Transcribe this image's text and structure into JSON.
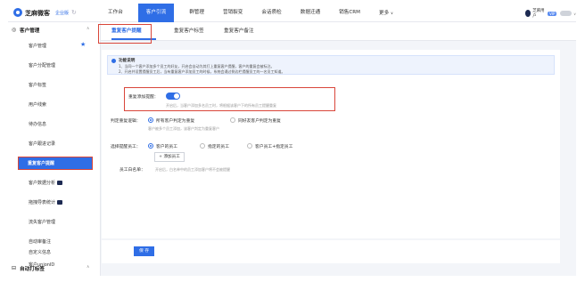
{
  "app": {
    "title": "芝麻微客",
    "version": "企业版"
  },
  "nav": {
    "items": [
      "工作台",
      "客户引流",
      "群管理",
      "营销裂变",
      "会话质检",
      "数据迁通",
      "销售CRM",
      "更多"
    ],
    "more_arrow": "∨"
  },
  "user": {
    "name": "芝麻用户",
    "badge": "VIP"
  },
  "sidebar": {
    "group1": "客户管理",
    "items": [
      "客户管理",
      "客户分配管理",
      "客户标签",
      "用户线索",
      "待办信息",
      "客户跟进记录",
      "重复客户提醒",
      "客户数据分析",
      "拖拽导表统计",
      "流失客户管理",
      "自动审备注",
      "自定义信息",
      "客户unionID"
    ],
    "group2": "自动打标签"
  },
  "tabs": [
    "重复客户提醒",
    "重复客户标签",
    "重复客户备注"
  ],
  "notice": {
    "title": "功能说明",
    "lines": [
      "1、当同一个客户添加多个员工的好友，开启会自动为其打上重复客户提醒，客户的重复会被标注。",
      "2、开启并设置提醒员工后，当有重复客户添加员工的时候，系统会通过侧边栏提醒员工的一名员工知道。"
    ]
  },
  "settings": {
    "toggle_label": "重复添加提醒：",
    "toggle_hint": "开启后，当客户添加多名员工时，将根据该客户下的所有员工提醒重复",
    "logic_label": "判定重复逻辑：",
    "logic_options": [
      "所有客户判定为重复",
      "同好友客户判定为重复"
    ],
    "logic_hint": "客户被多个员工添加，该客户判定为重复客户",
    "employee_label": "选择提醒员工：",
    "employee_options": [
      "客户的员工",
      "指定的员工",
      "客户员工+指定员工"
    ],
    "whitelist_label": "员工白名单：",
    "whitelist_hint": "开启后，白名单中的员工添加客户将不会被提醒",
    "add_button": "+ 添加员工"
  },
  "footer": {
    "save_label": "保 存"
  }
}
